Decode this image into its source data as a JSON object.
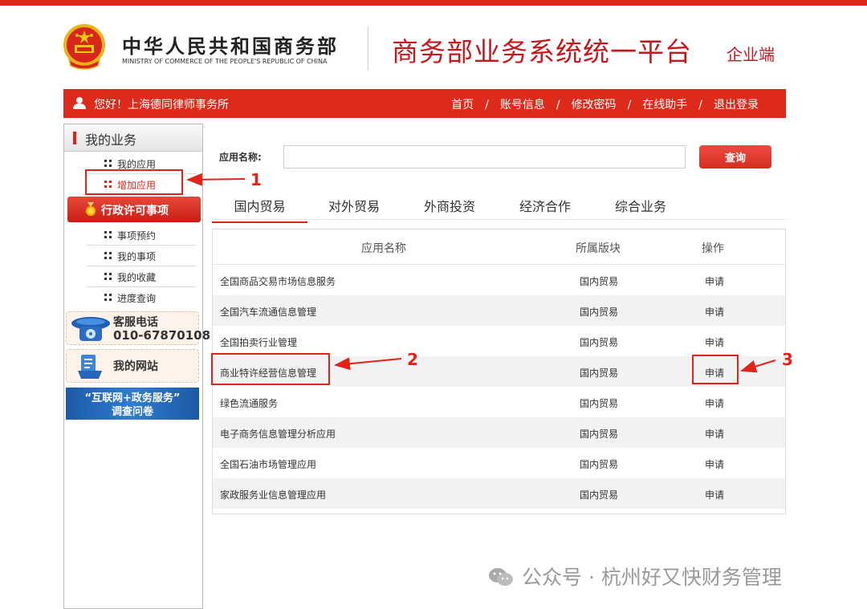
{
  "header": {
    "ministry_cn": "中华人民共和国商务部",
    "ministry_en": "MINISTRY OF COMMERCE OF THE PEOPLE'S REPUBLIC OF CHINA",
    "platform_title": "商务部业务系统统一平台",
    "platform_sub": "企业端"
  },
  "nav": {
    "greeting": "您好！上海德同律师事务所",
    "links": [
      "首页",
      "账号信息",
      "修改密码",
      "在线助手",
      "退出登录"
    ],
    "separator": "/"
  },
  "sidebar": {
    "title": "我的业务",
    "items_top": [
      "我的应用",
      "增加应用"
    ],
    "admin_section": "行政许可事项",
    "items_admin": [
      "事项预约",
      "我的事项",
      "我的收藏",
      "进度查询"
    ],
    "service_phone_label": "客服电话",
    "service_phone": "010-67870108",
    "my_site": "我的网站",
    "survey_line1": "“互联网+政务服务”",
    "survey_line2": "调查问卷"
  },
  "search": {
    "label": "应用名称:",
    "value": "",
    "button": "查询"
  },
  "tabs": [
    "国内贸易",
    "对外贸易",
    "外商投资",
    "经济合作",
    "综合业务"
  ],
  "table": {
    "headers": [
      "应用名称",
      "所属版块",
      "操作"
    ],
    "rows": [
      {
        "name": "全国商品交易市场信息服务",
        "module": "国内贸易",
        "action": "申请"
      },
      {
        "name": "全国汽车流通信息管理",
        "module": "国内贸易",
        "action": "申请"
      },
      {
        "name": "全国拍卖行业管理",
        "module": "国内贸易",
        "action": "申请"
      },
      {
        "name": "商业特许经营信息管理",
        "module": "国内贸易",
        "action": "申请"
      },
      {
        "name": "绿色流通服务",
        "module": "国内贸易",
        "action": "申请"
      },
      {
        "name": "电子商务信息管理分析应用",
        "module": "国内贸易",
        "action": "申请"
      },
      {
        "name": "全国石油市场管理应用",
        "module": "国内贸易",
        "action": "申请"
      },
      {
        "name": "家政服务业信息管理应用",
        "module": "国内贸易",
        "action": "申请"
      }
    ]
  },
  "annotations": [
    "1",
    "2",
    "3"
  ],
  "watermark": "公众号 · 杭州好又快财务管理",
  "colors": {
    "brand_red": "#e2231a",
    "nav_red": "#dd2a1b",
    "platform_red": "#c8161d"
  }
}
